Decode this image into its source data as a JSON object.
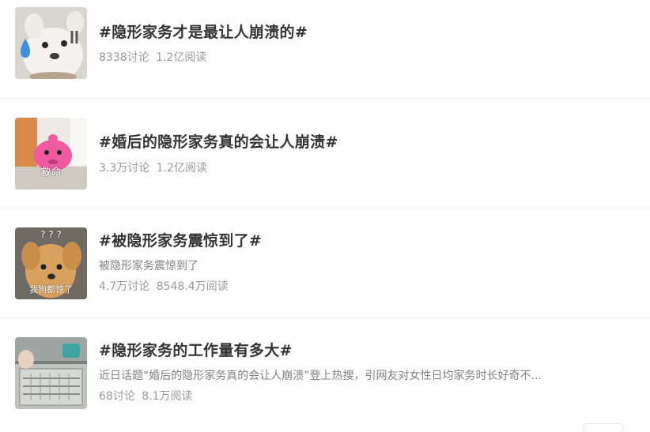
{
  "topics": [
    {
      "title": "#隐形家务才是最让人崩溃的#",
      "description": "",
      "discussions": "8338讨论",
      "reads": "1.2亿阅读",
      "thumbnail_icon": "white-dog-sweat-icon"
    },
    {
      "title": "#婚后的隐形家务真的会让人崩溃#",
      "description": "",
      "discussions": "3.3万讨论",
      "reads": "1.2亿阅读",
      "thumbnail_icon": "pink-creature-icon",
      "thumbnail_caption": "救命"
    },
    {
      "title": "#被隐形家务震惊到了#",
      "description": "被隐形家务震惊到了",
      "discussions": "4.7万讨论",
      "reads": "8548.4万阅读",
      "thumbnail_icon": "puppy-icon",
      "thumbnail_top_caption": "? ? ?",
      "thumbnail_caption": "我狗都惊了"
    },
    {
      "title": "#隐形家务的工作量有多大#",
      "description": "近日话题“婚后的隐形家务真的会让人崩溃”登上热搜，引网友对女性日均家务时长好奇不...",
      "discussions": "68讨论",
      "reads": "8.1万阅读",
      "thumbnail_icon": "kitchen-dishwasher-icon"
    }
  ],
  "colors": {
    "title": "#333333",
    "description": "#808080",
    "stats": "#999999",
    "divider": "#f0f0f0"
  }
}
